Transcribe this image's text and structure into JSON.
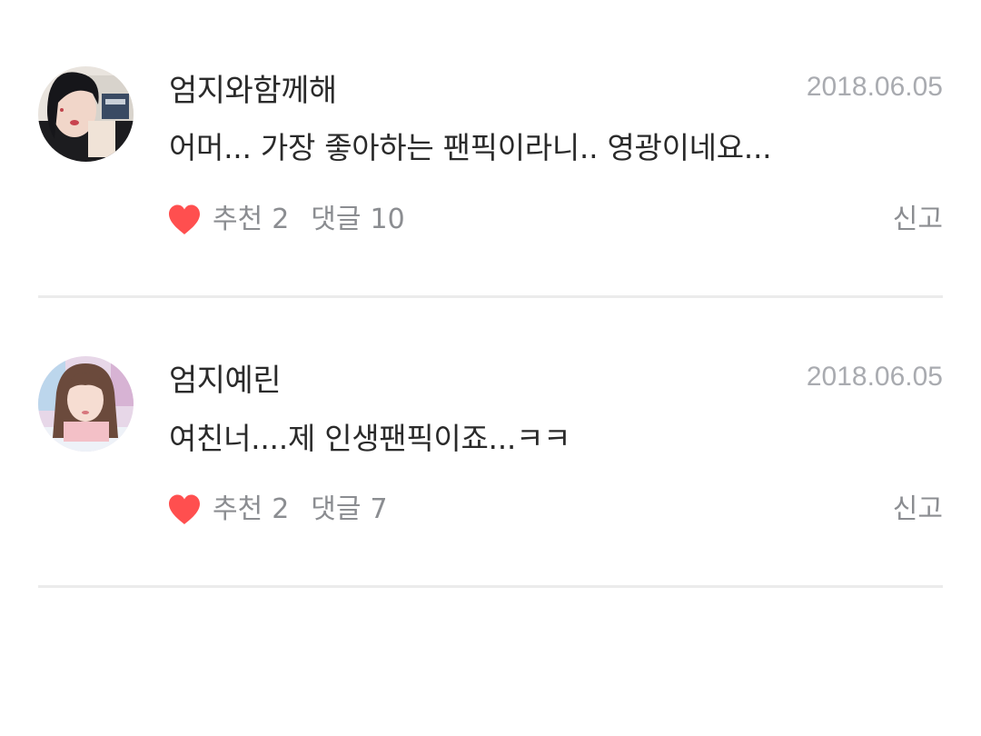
{
  "comments": [
    {
      "username": "엄지와함께해",
      "date": "2018.06.05",
      "text": "어머... 가장 좋아하는 팬픽이라니.. 영광이네요...",
      "like_label": "추천",
      "like_count": "2",
      "reply_label": "댓글",
      "reply_count": "10",
      "report_label": "신고"
    },
    {
      "username": "엄지예린",
      "date": "2018.06.05",
      "text": "여친너....제 인생팬픽이죠...ㅋㅋ",
      "like_label": "추천",
      "like_count": "2",
      "reply_label": "댓글",
      "reply_count": "7",
      "report_label": "신고"
    }
  ],
  "colors": {
    "heart": "#ff4f4f",
    "username": "#2a2a2a",
    "meta": "#8b8d91",
    "date": "#a9abb0",
    "divider": "#ebebeb"
  },
  "icons": {
    "like": "heart-icon",
    "avatar": "avatar"
  }
}
